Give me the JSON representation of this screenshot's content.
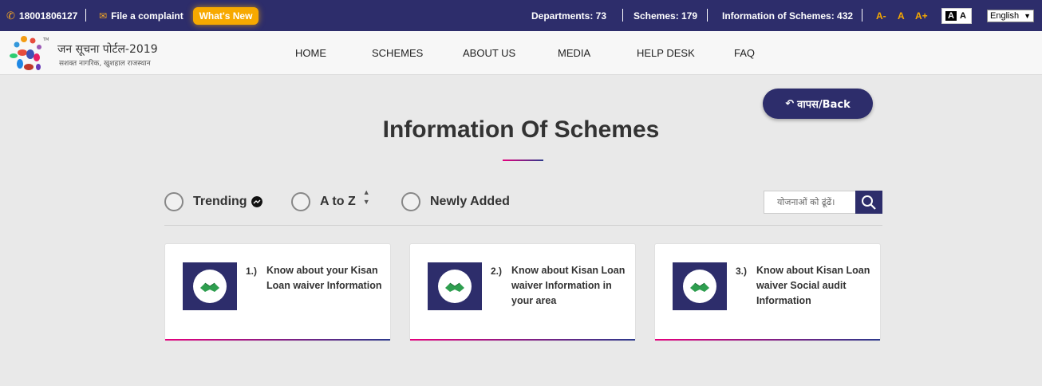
{
  "topbar": {
    "phone": "18001806127",
    "complaint": "File a complaint",
    "whats_new": "What's New",
    "departments": "Departments: 73",
    "schemes": "Schemes: 179",
    "info_schemes": "Information of Schemes: 432",
    "font_decrease": "A-",
    "font_normal": "A",
    "font_increase": "A+",
    "contrast_dark": "A",
    "contrast_light": "A",
    "language": "English"
  },
  "header": {
    "logo_title": "जन सूचना पोर्टल-2019",
    "logo_subtitle": "सशक्त नागरिक, खुशहाल राजस्थान",
    "logo_tm": "TM",
    "nav": [
      "HOME",
      "SCHEMES",
      "ABOUT US",
      "MEDIA",
      "HELP DESK",
      "FAQ"
    ]
  },
  "main": {
    "back_label": "वापस/Back",
    "title": "Information Of Schemes",
    "filters": {
      "trending": "Trending",
      "atoz": "A to Z",
      "newly": "Newly Added"
    },
    "search_placeholder": "योजनाओं को ढूंढें।",
    "cards": [
      {
        "num": "1.)",
        "text": "Know about your Kisan Loan waiver Information"
      },
      {
        "num": "2.)",
        "text": "Know about Kisan Loan waiver Information in your area"
      },
      {
        "num": "3.)",
        "text": "Know about Kisan Loan waiver Social audit Information"
      }
    ]
  },
  "colors": {
    "navy": "#2d2d6b",
    "accent_orange": "#f7a900",
    "pink": "#e6007e"
  }
}
